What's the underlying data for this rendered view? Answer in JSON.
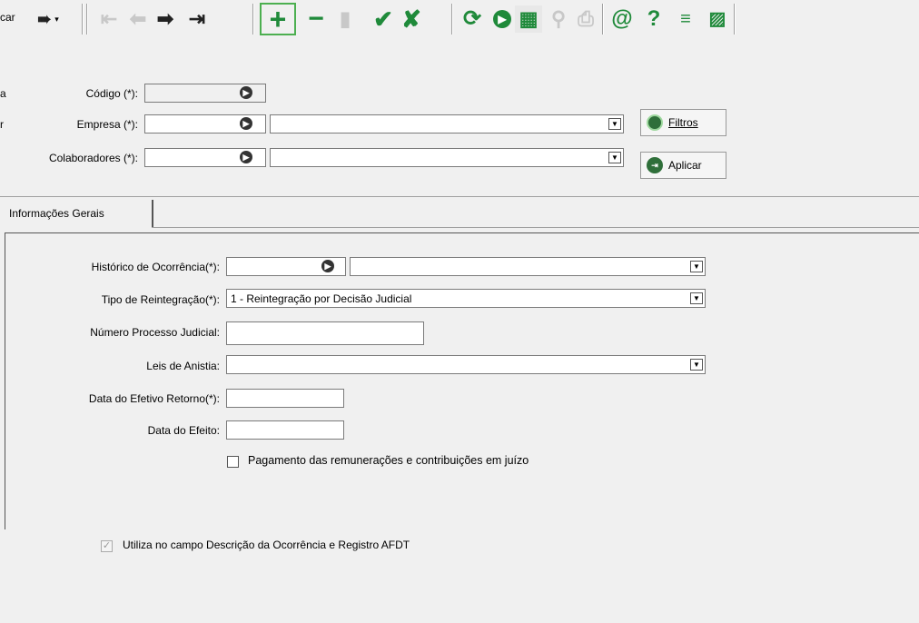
{
  "toolbar": {
    "nav_label": "car",
    "buttons": [
      "first-icon",
      "prev-icon",
      "next-icon",
      "last-icon",
      "add-icon",
      "remove-icon",
      "paste-icon",
      "confirm-icon",
      "cancel-icon",
      "refresh-icon",
      "play-icon",
      "grid-icon",
      "search-icon",
      "print-icon",
      "email-icon",
      "help-icon",
      "filter-icon",
      "clear-grid-icon"
    ]
  },
  "header": {
    "codigo_label": "Código (*):",
    "empresa_label": "Empresa (*):",
    "colaboradores_label": "Colaboradores (*):",
    "edge_a": "a",
    "edge_r": "r",
    "filtros_label": "Filtros",
    "aplicar_label": "Aplicar"
  },
  "tabs": [
    {
      "label": "Informações Gerais"
    }
  ],
  "form": {
    "historico_label": "Histórico de Ocorrência(*):",
    "tipo_label": "Tipo de Reintegração(*):",
    "tipo_value": "1 - Reintegração por Decisão Judicial",
    "numero_label": "Número Processo Judicial:",
    "leis_label": "Leis de Anistia:",
    "data_retorno_label": "Data do Efetivo Retorno(*):",
    "data_efeito_label": "Data do Efeito:",
    "pagamento_label": "Pagamento das remunerações e contribuições em juízo"
  },
  "footer": {
    "utiliza_label": "Utiliza no campo Descrição da Ocorrência e Registro AFDT"
  }
}
